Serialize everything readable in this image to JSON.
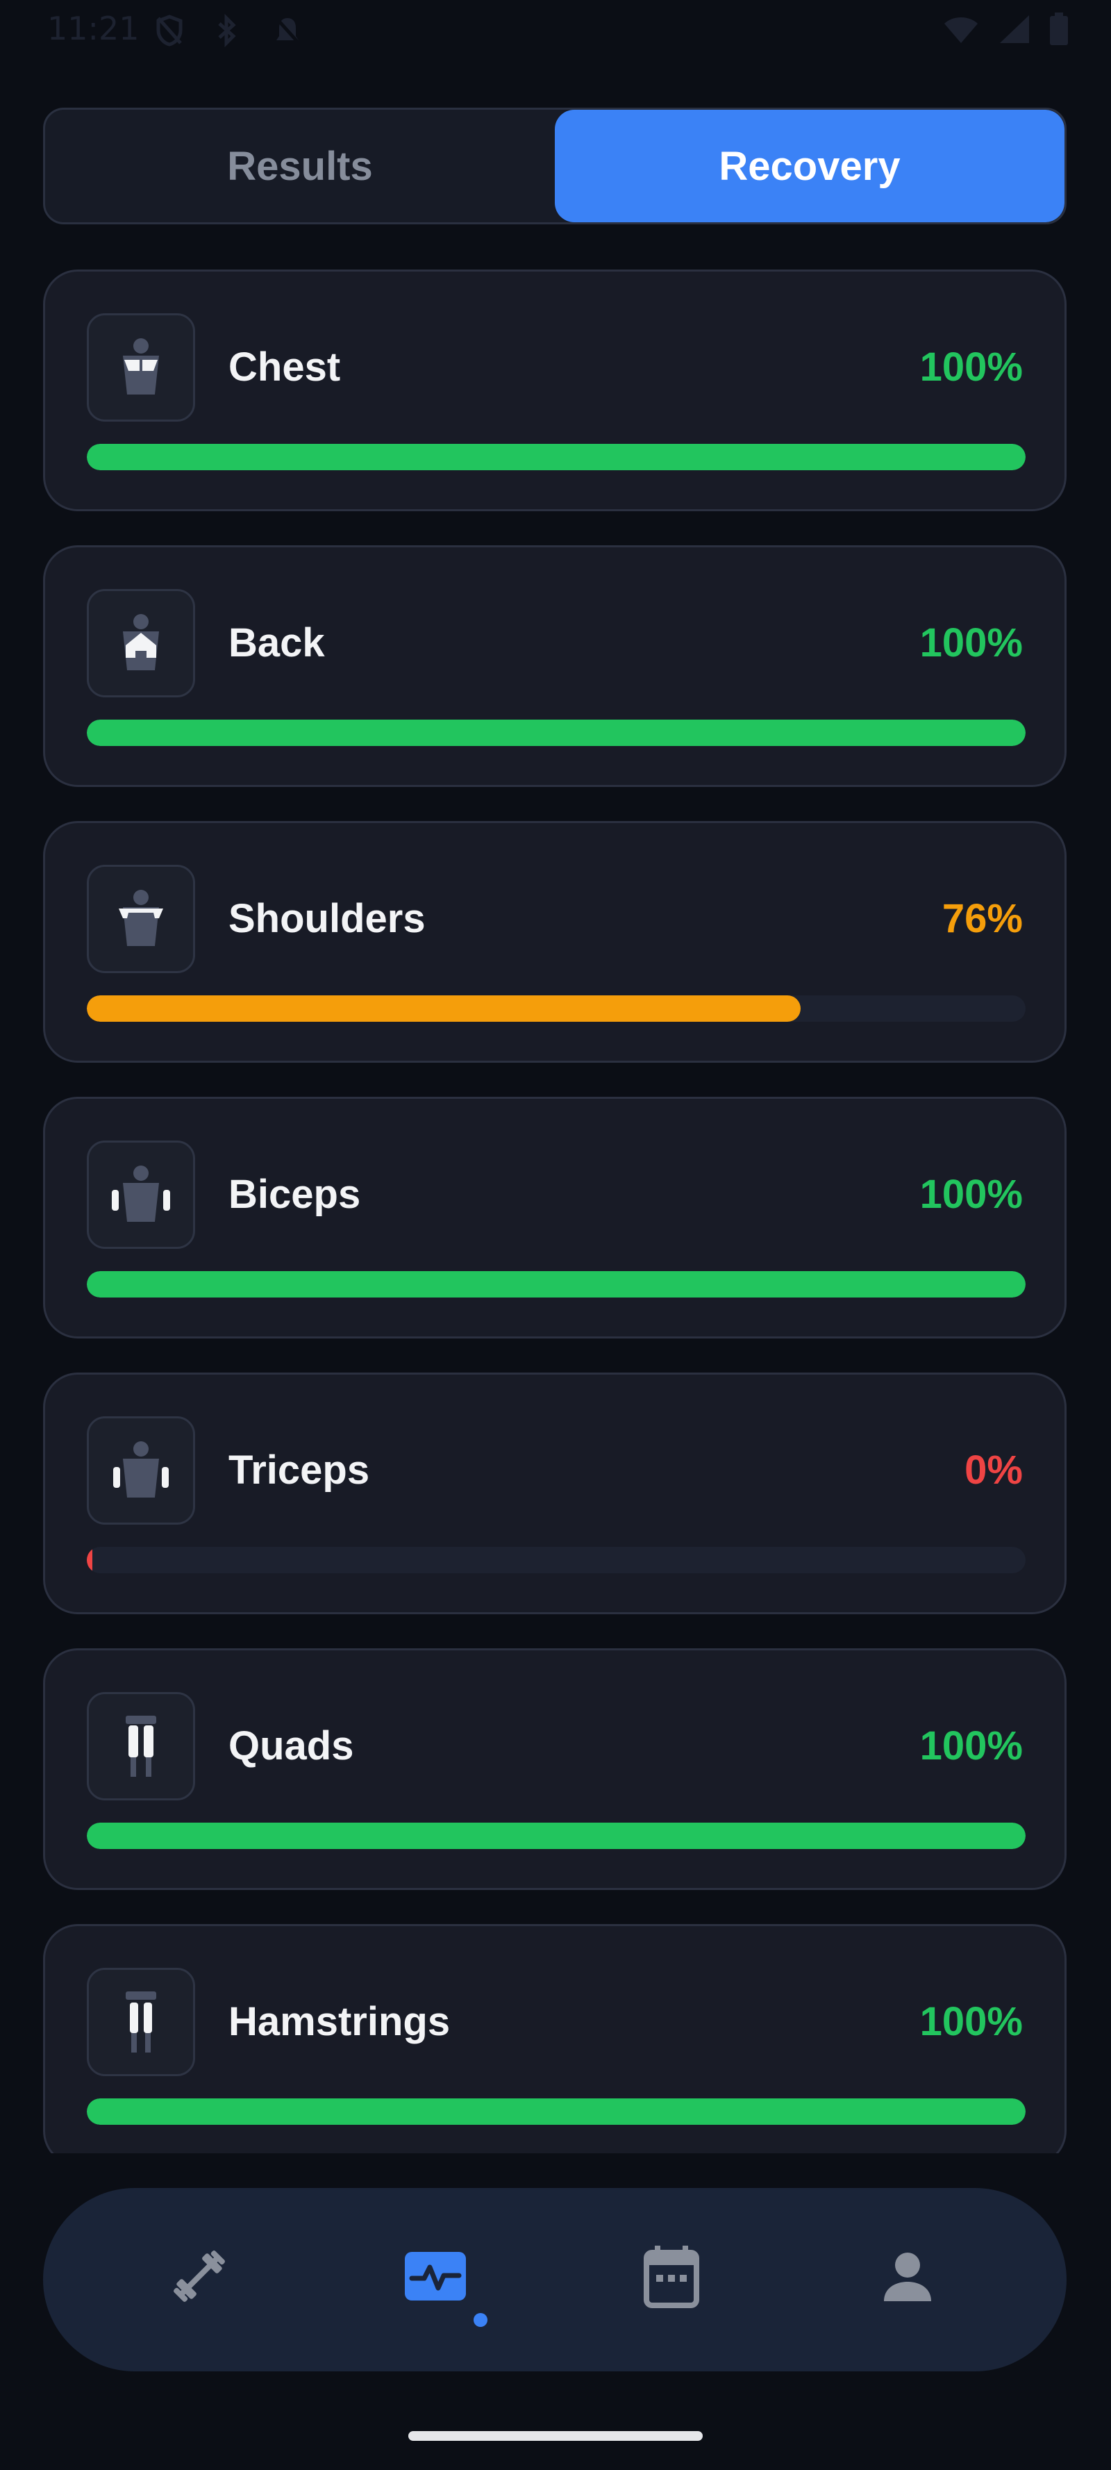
{
  "status_bar": {
    "time": "11:21"
  },
  "tabs": {
    "results_label": "Results",
    "recovery_label": "Recovery",
    "active": "Recovery"
  },
  "colors": {
    "green": "#22c55e",
    "orange": "#f59e0b",
    "red": "#ef4444",
    "accent": "#3b82f6"
  },
  "muscles": [
    {
      "name": "Chest",
      "percent_label": "100%",
      "recovery": 1.0,
      "status": "green",
      "icon": "chest-icon"
    },
    {
      "name": "Back",
      "percent_label": "100%",
      "recovery": 1.0,
      "status": "green",
      "icon": "back-icon"
    },
    {
      "name": "Shoulders",
      "percent_label": "76%",
      "recovery": 0.76,
      "status": "orange",
      "icon": "shoulders-icon"
    },
    {
      "name": "Biceps",
      "percent_label": "100%",
      "recovery": 1.0,
      "status": "green",
      "icon": "biceps-icon"
    },
    {
      "name": "Triceps",
      "percent_label": "0%",
      "recovery": 0.0,
      "status": "red",
      "icon": "triceps-icon"
    },
    {
      "name": "Quads",
      "percent_label": "100%",
      "recovery": 1.0,
      "status": "green",
      "icon": "quads-icon"
    },
    {
      "name": "Hamstrings",
      "percent_label": "100%",
      "recovery": 1.0,
      "status": "green",
      "icon": "hamstrings-icon"
    }
  ],
  "nav": [
    {
      "icon": "dumbbell-icon",
      "active": false
    },
    {
      "icon": "activity-icon",
      "active": true
    },
    {
      "icon": "calendar-icon",
      "active": false
    },
    {
      "icon": "person-icon",
      "active": false
    }
  ]
}
